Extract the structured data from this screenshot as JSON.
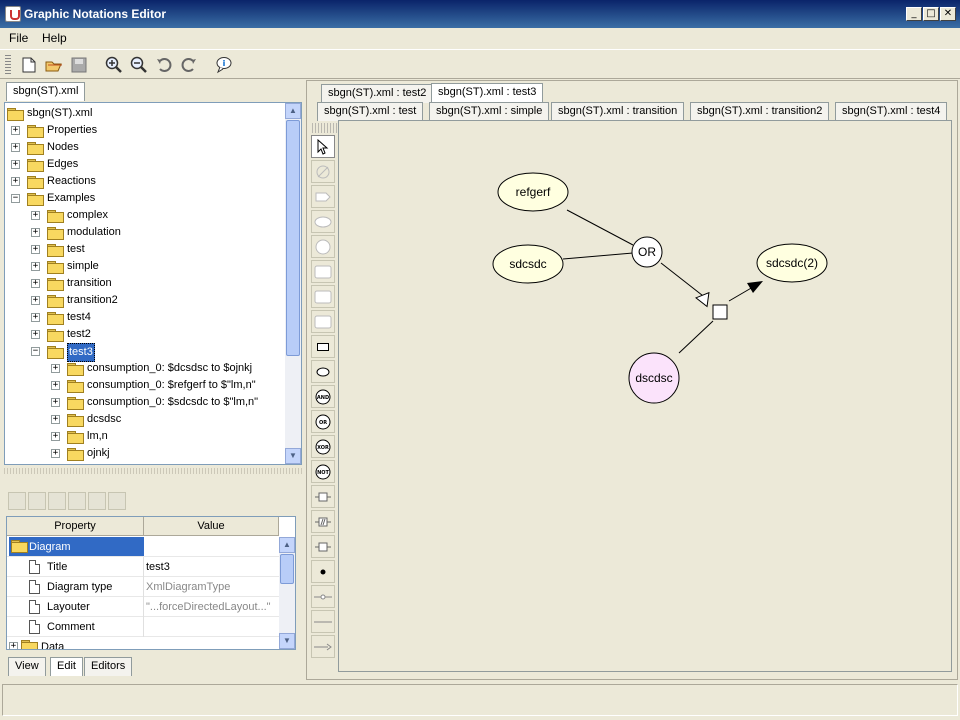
{
  "window": {
    "title": "Graphic Notations Editor",
    "btn_min": "_",
    "btn_max": "□",
    "btn_close": "✕"
  },
  "menu": {
    "file": "File",
    "help": "Help"
  },
  "toolbar": {
    "icons": [
      "new-icon",
      "open-icon",
      "save-icon",
      "zoom-in-icon",
      "zoom-out-icon",
      "undo-icon",
      "redo-icon",
      "info-icon"
    ]
  },
  "left": {
    "tree_tab": "sbgn(ST).xml",
    "tree": {
      "root": "sbgn(ST).xml",
      "items": [
        {
          "label": "Properties",
          "level": 1,
          "pm": "+"
        },
        {
          "label": "Nodes",
          "level": 1,
          "pm": "+"
        },
        {
          "label": "Edges",
          "level": 1,
          "pm": "+"
        },
        {
          "label": "Reactions",
          "level": 1,
          "pm": "+"
        },
        {
          "label": "Examples",
          "level": 1,
          "pm": "−",
          "open": true
        },
        {
          "label": "complex",
          "level": 2,
          "pm": "+"
        },
        {
          "label": "modulation",
          "level": 2,
          "pm": "+"
        },
        {
          "label": "test",
          "level": 2,
          "pm": "+"
        },
        {
          "label": "simple",
          "level": 2,
          "pm": "+"
        },
        {
          "label": "transition",
          "level": 2,
          "pm": "+"
        },
        {
          "label": "transition2",
          "level": 2,
          "pm": "+"
        },
        {
          "label": "test4",
          "level": 2,
          "pm": "+"
        },
        {
          "label": "test2",
          "level": 2,
          "pm": "+"
        },
        {
          "label": "test3",
          "level": 2,
          "pm": "−",
          "open": true,
          "selected": true
        },
        {
          "label": "consumption_0: $dcsdsc to $ojnkj",
          "level": 3,
          "pm": "+"
        },
        {
          "label": "consumption_0: $refgerf to $\"lm,n\"",
          "level": 3,
          "pm": "+"
        },
        {
          "label": "consumption_0: $sdcsdc to $\"lm,n\"",
          "level": 3,
          "pm": "+"
        },
        {
          "label": "dcsdsc",
          "level": 3,
          "pm": "+"
        },
        {
          "label": "lm,n",
          "level": 3,
          "pm": "+"
        },
        {
          "label": "ojnkj",
          "level": 3,
          "pm": "+"
        }
      ]
    },
    "props": {
      "col_property": "Property",
      "col_value": "Value",
      "group": "Diagram",
      "rows": [
        {
          "name": "Title",
          "value": "test3",
          "dim": false
        },
        {
          "name": "Diagram type",
          "value": "XmlDiagramType",
          "dim": true
        },
        {
          "name": "Layouter",
          "value": "\"...forceDirectedLayout...\"",
          "dim": true
        },
        {
          "name": "Comment",
          "value": "",
          "dim": false
        }
      ],
      "next_group": "Data"
    },
    "bottom_tabs": [
      "View",
      "Edit",
      "Editors"
    ]
  },
  "editor": {
    "tabs_row1": [
      "sbgn(ST).xml : test2",
      "sbgn(ST).xml : test3"
    ],
    "tabs_row2": [
      "sbgn(ST).xml : test",
      "sbgn(ST).xml : simple",
      "sbgn(ST).xml : transition",
      "sbgn(ST).xml : transition2",
      "sbgn(ST).xml : test4"
    ],
    "active_tab": "sbgn(ST).xml : test3",
    "palette": [
      "select-icon",
      "empty-set-icon",
      "tag-icon",
      "ellipse-icon",
      "circle-icon",
      "rect-icon",
      "rect-icon",
      "rect-icon",
      "box-icon",
      "oval-icon",
      "and-icon",
      "or-icon",
      "xor-icon",
      "not-icon",
      "process-icon",
      "omitted-process-icon",
      "uncertain-process-icon",
      "dot-icon",
      "edge-icon",
      "line-icon",
      "arrow-icon"
    ],
    "gate_labels": {
      "and": "AND",
      "or": "OR",
      "xor": "XOR",
      "not": "NOT"
    },
    "diagram": {
      "nodes": [
        {
          "id": "refgerf",
          "label": "refgerf",
          "fill": "#ffffe0"
        },
        {
          "id": "sdcsdc",
          "label": "sdcsdc",
          "fill": "#ffffe0"
        },
        {
          "id": "or",
          "label": "OR",
          "fill": "#ffffff"
        },
        {
          "id": "sdcsdc2",
          "label": "sdcsdc(2)",
          "fill": "#ffffe0"
        },
        {
          "id": "dcsdsc",
          "label": "dscdsc",
          "fill": "#fbe3fb"
        }
      ]
    }
  }
}
